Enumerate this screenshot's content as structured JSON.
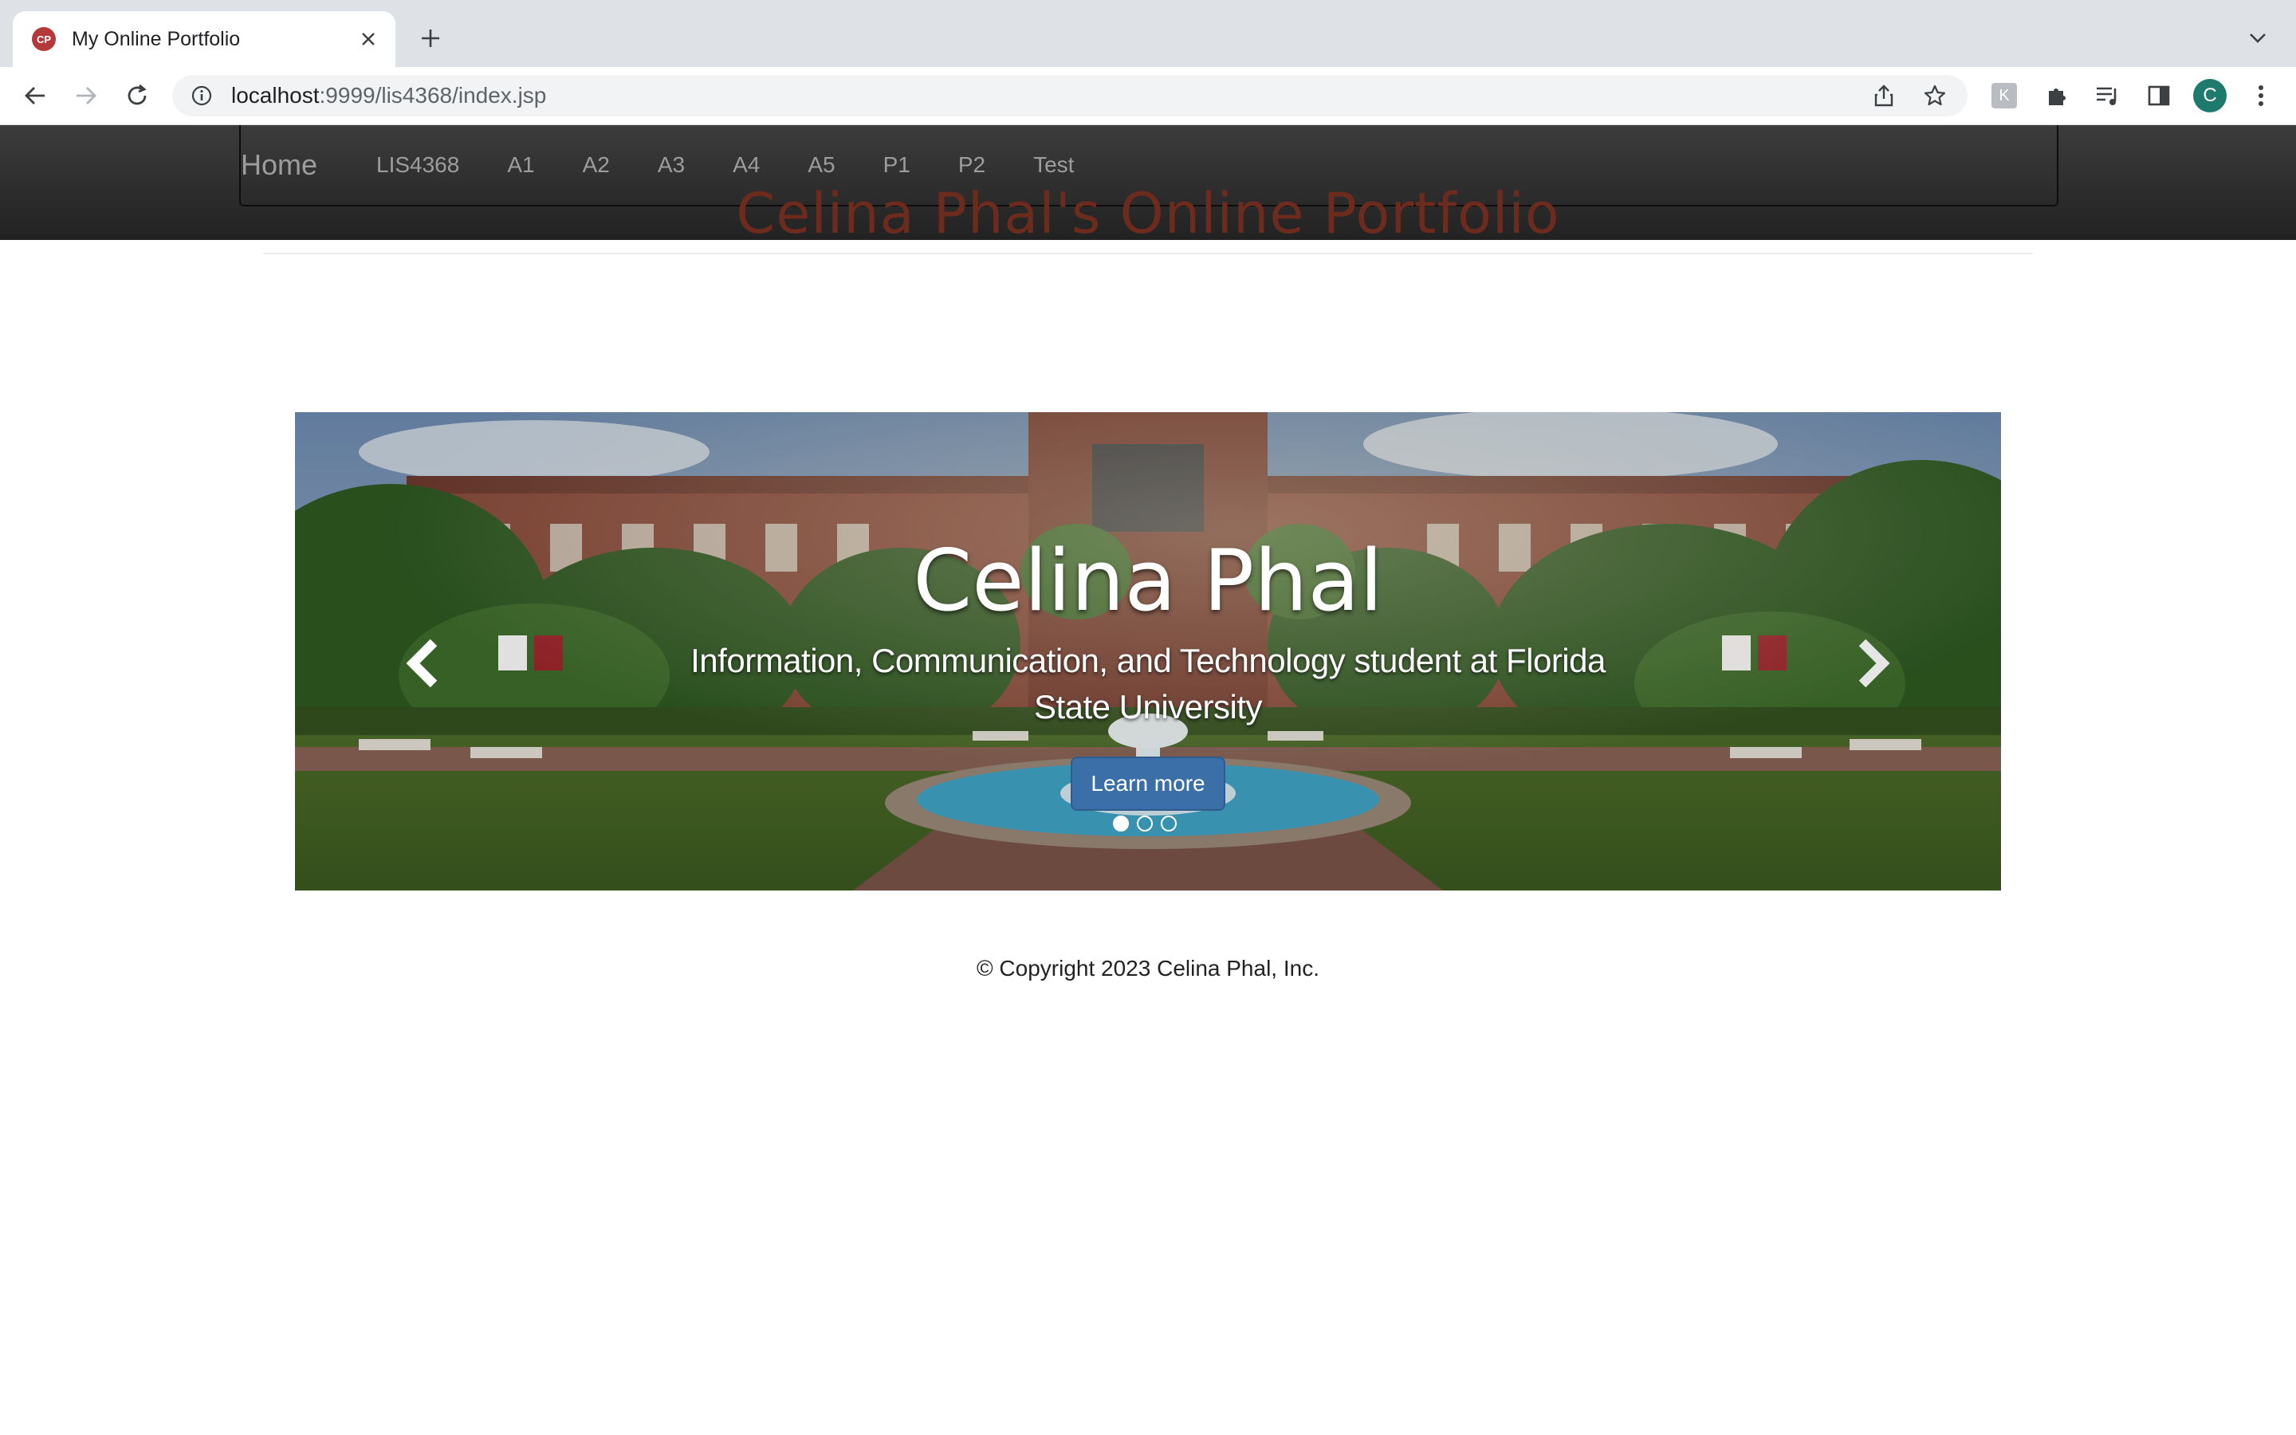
{
  "browser": {
    "tab_title": "My Online Portfolio",
    "favicon_text": "CP",
    "url_host": "localhost",
    "url_rest": ":9999/lis4368/index.jsp",
    "profile_initial": "C"
  },
  "navbar": {
    "brand": "Home",
    "links": [
      "LIS4368",
      "A1",
      "A2",
      "A3",
      "A4",
      "A5",
      "P1",
      "P2",
      "Test"
    ]
  },
  "page": {
    "heading": "Celina Phal's Online Portfolio"
  },
  "carousel": {
    "title": "Celina Phal",
    "text": "Information, Communication, and Technology student at Florida State University",
    "button_label": "Learn more",
    "slide_count": 3,
    "active_slide": 1
  },
  "footer": {
    "text": "© Copyright 2023 Celina Phal, Inc."
  },
  "colors": {
    "heading": "#6d2b1e",
    "navbar": "#222222",
    "button": "#3a6fa8"
  }
}
